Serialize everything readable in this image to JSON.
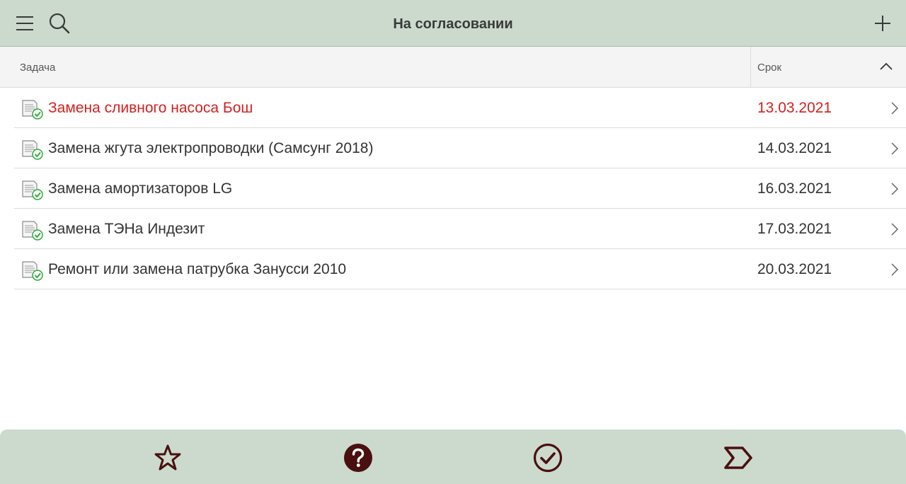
{
  "header": {
    "title": "На согласовании"
  },
  "columns": {
    "task": "Задача",
    "date": "Срок"
  },
  "tasks": [
    {
      "title": "Замена сливного насоса Бош",
      "date": "13.03.2021",
      "overdue": true
    },
    {
      "title": "Замена жгута электропроводки (Самсунг 2018)",
      "date": "14.03.2021",
      "overdue": false
    },
    {
      "title": "Замена амортизаторов LG",
      "date": "16.03.2021",
      "overdue": false
    },
    {
      "title": "Замена ТЭНа Индезит",
      "date": "17.03.2021",
      "overdue": false
    },
    {
      "title": "Ремонт или замена патрубка Занусси 2010",
      "date": "20.03.2021",
      "overdue": false
    }
  ],
  "icons": {
    "menu": "hamburger-icon",
    "search": "search-icon",
    "add": "plus-icon",
    "sort": "chevron-up-icon",
    "row_arrow": "chevron-right-icon",
    "task_doc": "document-check-icon",
    "bottom": [
      "star-icon",
      "question-icon",
      "check-circle-icon",
      "arrow-forward-icon"
    ]
  },
  "colors": {
    "bar_bg": "#cbdacd",
    "overdue": "#d42020",
    "bottom_icon": "#4a0f0f",
    "check_green": "#2eaa3a"
  }
}
